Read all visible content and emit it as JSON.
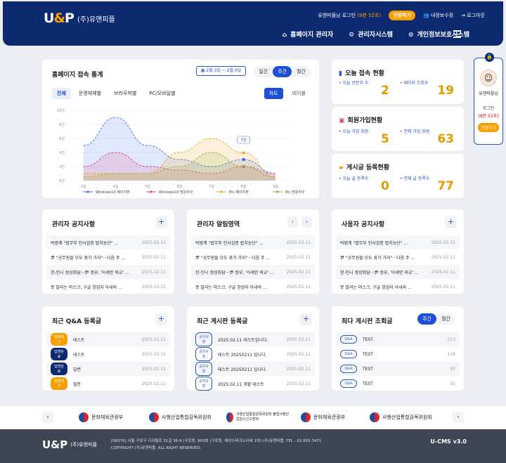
{
  "header": {
    "logo": "U&P",
    "company": "(주)유앤피플",
    "user_msg": "유앤피플님 로그인",
    "timer": "(9분 52초)",
    "extend": "연장하기",
    "myinfo": "내정보수정",
    "logout": "로그아웃",
    "nav": [
      {
        "icon": "home-icon",
        "label": "홈페이지 관리자"
      },
      {
        "icon": "gear-icon",
        "label": "관리자시스템"
      },
      {
        "icon": "lock-icon",
        "label": "개인정보보호시스템"
      }
    ]
  },
  "stats": {
    "title": "홈페이지 접속 통계",
    "date_range": "2월 3일 ~ 2월 9일",
    "periods": [
      "일간",
      "주간",
      "월간"
    ],
    "active_period": "주간",
    "filters": [
      "전체",
      "운영체제별",
      "브라우저별",
      "PC/모바일별"
    ],
    "active_filter": "전체",
    "views": [
      "차트",
      "테이블"
    ],
    "active_view": "차트"
  },
  "chart_data": {
    "type": "area",
    "y_ticks": [
      "10건",
      "8건",
      "6건",
      "4건",
      "2건",
      "0건"
    ],
    "x": [
      "3일",
      "4일",
      "5일",
      "6일",
      "7일",
      "8일",
      "9일"
    ],
    "ylim": [
      0,
      10
    ],
    "tooltip": "7건",
    "series": [
      {
        "name": "Windows10 페이지뷰",
        "color": "#3d6ef2",
        "marker": "circle",
        "values": [
          5,
          9,
          5,
          3,
          2,
          3,
          1
        ]
      },
      {
        "name": "Windows10 방문자수",
        "color": "#e0457a",
        "marker": "square",
        "values": [
          2,
          4,
          2,
          1.5,
          1,
          2,
          1
        ]
      },
      {
        "name": "Etc 페이지뷰",
        "color": "#f0a321",
        "marker": "triangle",
        "values": [
          1,
          1,
          1,
          4,
          6,
          4,
          0.5
        ]
      },
      {
        "name": "Etc 방문자수",
        "color": "#8fb43a",
        "marker": "tri-down",
        "values": [
          0.5,
          1,
          1,
          2,
          4,
          2,
          0.5
        ]
      }
    ]
  },
  "today": {
    "title": "오늘 접속 현황",
    "l1": "오늘 방문자 수",
    "v1": "2",
    "l2": "페이지 조회수",
    "v2": "19"
  },
  "member": {
    "title": "회원가입현황",
    "l1": "오늘 가입 회원",
    "v1": "5",
    "l2": "전체 가입 회원",
    "v2": "63"
  },
  "posts": {
    "title": "게시글 등록현황",
    "l1": "오늘 글 등록수",
    "v1": "0",
    "l2": "전체 글 등록수",
    "v2": "77"
  },
  "profile": {
    "name": "유앤피플님",
    "login": "로그인",
    "timer": "(9분 52초)",
    "extend": "연장하기"
  },
  "notice_rows": [
    {
      "t": "박범계 \"법무부 인사검증 법치농단\" ...",
      "d": "2025.02.11"
    },
    {
      "t": "尹 \"공무원들 모두 휴가 가라\"···다음 주 ...",
      "d": "2025.02.11"
    },
    {
      "t": "한-인니 정상회담···尹 정부, '아세안 외교' ...",
      "d": "2025.02.11"
    },
    {
      "t": "못 말리는 머스크, 구글 창업자 아내와 ...",
      "d": "2025.02.11"
    }
  ],
  "admin_notice": {
    "title": "관리자 공지사항"
  },
  "admin_alert": {
    "title": "관리자 알림영역"
  },
  "user_notice": {
    "title": "사용자 공지사항"
  },
  "qna": {
    "title": "최근 Q&A 등록글",
    "rows": [
      {
        "b": "답변대기",
        "t": "테스트",
        "d": "2025.02.11"
      },
      {
        "b": "답변완료",
        "t": "테스트",
        "d": "2025.02.11"
      },
      {
        "b": "답변완료",
        "t": "답변",
        "d": "2025.02.11"
      },
      {
        "b": "답변대기",
        "t": "질문",
        "d": "2025.02.11"
      }
    ]
  },
  "board": {
    "title": "최근 게시판 등록글",
    "rows": [
      {
        "b": "공지사항",
        "t": "2025.02.11 테스트입니다.",
        "d": "2025.02.11"
      },
      {
        "b": "공지사항",
        "t": "테스트 20250211 입니다.",
        "d": "2025.02.11"
      },
      {
        "b": "공지사항",
        "t": "테스트 20250211 입니다.",
        "d": "2025.02.11"
      },
      {
        "b": "공지사항",
        "t": "2025.02.11 게할 테스트",
        "d": "2025.02.11"
      }
    ]
  },
  "views": {
    "title": "최다 게시판 조회글",
    "tabs": [
      "주간",
      "월간"
    ],
    "rows": [
      {
        "b": "Q&A",
        "t": "TEST",
        "d": "213"
      },
      {
        "b": "Q&A",
        "t": "TEST",
        "d": "128"
      },
      {
        "b": "Q&A",
        "t": "TEST",
        "d": "97"
      },
      {
        "b": "Q&A",
        "t": "TEST",
        "d": "35"
      }
    ]
  },
  "banners": [
    "문화체육관광부",
    "사행산업통합감독위원회",
    "사행산업통합감독위원회 불법사행산업감시신고센터",
    "문화체육관광부",
    "사행산업통합감독위원회"
  ],
  "footer": {
    "logo": "U&P",
    "company": "(주)유앤피플",
    "addr": "[08376] 서울 구로구 디지털로 31길 38-9 (구로동, 803호 (구로동, 에이스테크노타워 1차) (주)유앤피플, TEL : 02.855.7471",
    "copy": "COPYRIGHT (주)유앤피플. ALL RIGHT RESERVED.",
    "version": "U-CMS v3.0"
  }
}
